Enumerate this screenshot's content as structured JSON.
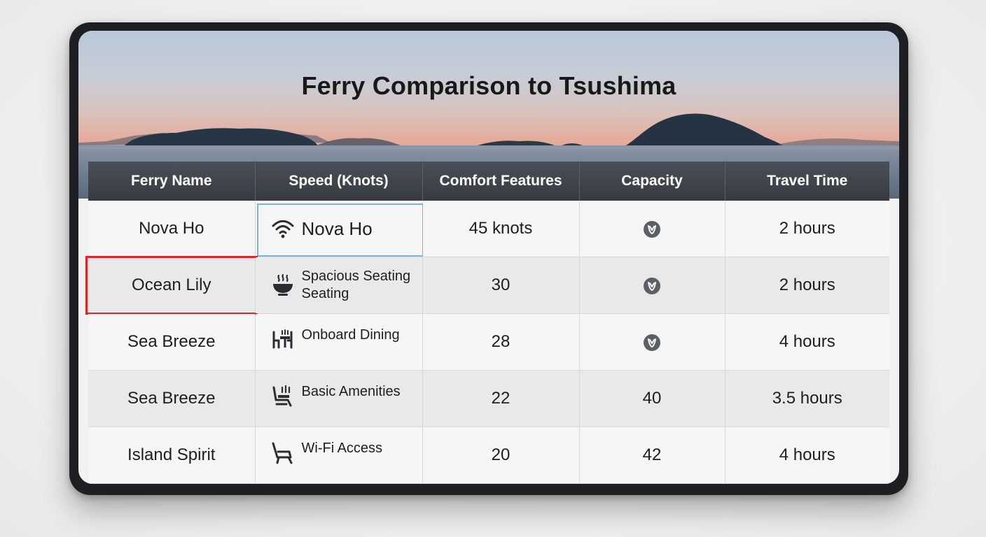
{
  "title": "Ferry Comparison to Tsushima",
  "columns": [
    "Ferry Name",
    "Speed (Knots)",
    "Comfort Features",
    "Capacity",
    "Travel Time"
  ],
  "rows": [
    {
      "name": "Nova Ho",
      "speed_icon": "wifi-icon",
      "speed_text": "Nova Ho",
      "comfort": "45 knots",
      "capacity_icon": "capacity-badge-icon",
      "capacity": "",
      "travel_time": "2 hours"
    },
    {
      "name": "Ocean Lily",
      "speed_icon": "steaming-bowl-icon",
      "speed_text_line1": "Spacious Seating",
      "speed_text_line2": "Seating",
      "comfort": "30",
      "capacity_icon": "capacity-badge-icon",
      "capacity": "",
      "travel_time": "2 hours"
    },
    {
      "name": "Sea Breeze",
      "speed_icon": "dining-table-icon",
      "speed_text": "Onboard Dining",
      "comfort": "28",
      "capacity_icon": "capacity-badge-icon",
      "capacity": "",
      "travel_time": "4 hours"
    },
    {
      "name": "Sea Breeze",
      "speed_icon": "seat-amenities-icon",
      "speed_text": "Basic Amenities",
      "comfort": "22",
      "capacity": "40",
      "travel_time": "3.5 hours"
    },
    {
      "name": "Island Spirit",
      "speed_icon": "reclining-seat-icon",
      "speed_text": "Wi-Fi Access",
      "comfort": "20",
      "capacity": "42",
      "travel_time": "4 hours"
    }
  ],
  "colors": {
    "header_bg": "#3c4047",
    "highlight_blue": "#7fb0e0",
    "highlight_red": "#e02424",
    "badge": "#5b5f66"
  }
}
